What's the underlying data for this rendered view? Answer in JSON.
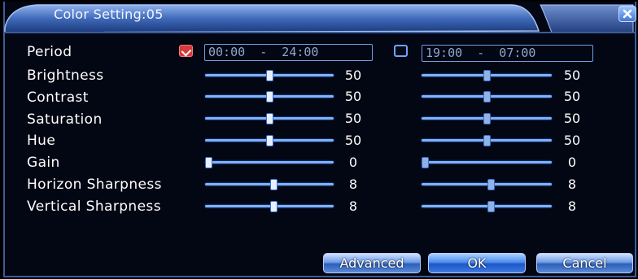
{
  "window": {
    "title": "Color Setting:05"
  },
  "periods": [
    {
      "checked": true,
      "time": "00:00  -  24:00"
    },
    {
      "checked": false,
      "time": "19:00  -  07:00"
    }
  ],
  "labels": {
    "period": "Period",
    "brightness": "Brightness",
    "contrast": "Contrast",
    "saturation": "Saturation",
    "hue": "Hue",
    "gain": "Gain",
    "horizon_sharpness": "Horizon Sharpness",
    "vertical_sharpness": "Vertical Sharpness"
  },
  "settings": {
    "p1": {
      "brightness": {
        "value": "50",
        "fraction": 0.5
      },
      "contrast": {
        "value": "50",
        "fraction": 0.5
      },
      "saturation": {
        "value": "50",
        "fraction": 0.5
      },
      "hue": {
        "value": "50",
        "fraction": 0.5
      },
      "gain": {
        "value": "0",
        "fraction": 0
      },
      "horizon_sharpness": {
        "value": "8",
        "fraction": 0.53
      },
      "vertical_sharpness": {
        "value": "8",
        "fraction": 0.53
      }
    },
    "p2": {
      "brightness": {
        "value": "50",
        "fraction": 0.5
      },
      "contrast": {
        "value": "50",
        "fraction": 0.5
      },
      "saturation": {
        "value": "50",
        "fraction": 0.5
      },
      "hue": {
        "value": "50",
        "fraction": 0.5
      },
      "gain": {
        "value": "0",
        "fraction": 0
      },
      "horizon_sharpness": {
        "value": "8",
        "fraction": 0.53
      },
      "vertical_sharpness": {
        "value": "8",
        "fraction": 0.53
      }
    }
  },
  "buttons": {
    "advanced": "Advanced",
    "ok": "OK",
    "cancel": "Cancel"
  },
  "colors": {
    "accent": "#6f9fe6",
    "background": "#030613",
    "checked": "#d63a3a"
  },
  "icons": {
    "close": "close-icon",
    "check": "checkmark-icon"
  }
}
